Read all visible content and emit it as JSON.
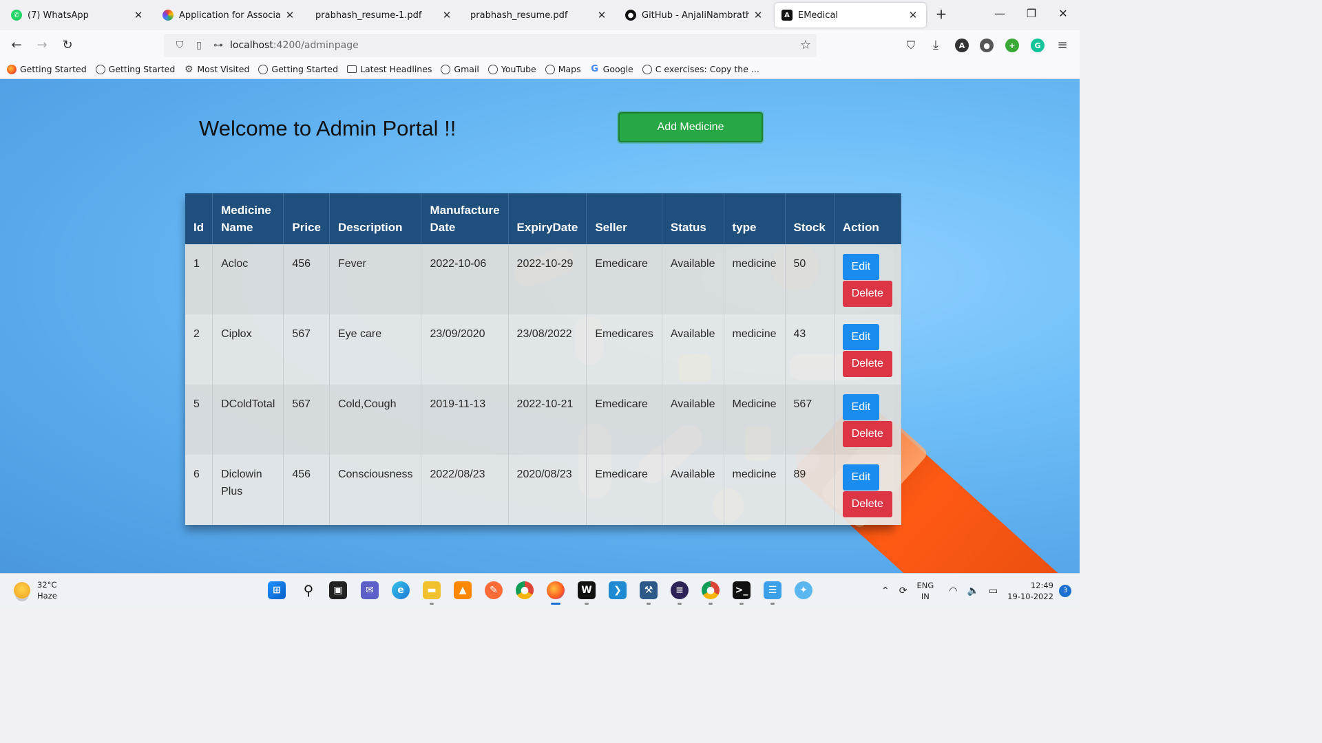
{
  "browser": {
    "tabs": [
      {
        "title": "(7) WhatsApp",
        "favicon": "whatsapp-icon",
        "color": "#25d366",
        "glyph": "✆",
        "active": false
      },
      {
        "title": "Application for Associate Softw",
        "favicon": "colorful-logo-icon",
        "color": "#7b3fe4",
        "glyph": "✿",
        "active": false
      },
      {
        "title": "prabhash_resume-1.pdf",
        "favicon": "",
        "color": "",
        "glyph": "",
        "active": false
      },
      {
        "title": "prabhash_resume.pdf",
        "favicon": "",
        "color": "",
        "glyph": "",
        "active": false
      },
      {
        "title": "GitHub - AnjaliNambrath/E-Me",
        "favicon": "github-icon",
        "color": "#111111",
        "glyph": "●",
        "active": false
      },
      {
        "title": "EMedical",
        "favicon": "angular-icon",
        "color": "#111111",
        "glyph": "A",
        "active": true
      }
    ],
    "url_host": "localhost",
    "url_path": ":4200/adminpage",
    "bookmarks": [
      {
        "label": "Getting Started",
        "icon": "firefox-icon"
      },
      {
        "label": "Getting Started",
        "icon": "globe-icon"
      },
      {
        "label": "Most Visited",
        "icon": "gear-icon"
      },
      {
        "label": "Getting Started",
        "icon": "globe-icon"
      },
      {
        "label": "Latest Headlines",
        "icon": "folder-icon"
      },
      {
        "label": "Gmail",
        "icon": "globe-icon"
      },
      {
        "label": "YouTube",
        "icon": "globe-icon"
      },
      {
        "label": "Maps",
        "icon": "globe-icon"
      },
      {
        "label": "Google",
        "icon": "google-icon"
      },
      {
        "label": "C exercises: Copy the ...",
        "icon": "globe-icon"
      }
    ]
  },
  "page": {
    "welcome": "Welcome to Admin Portal !!",
    "add_button": "Add Medicine",
    "table": {
      "headers": [
        "Id",
        "Medicine Name",
        "Price",
        "Description",
        "Manufacture Date",
        "ExpiryDate",
        "Seller",
        "Status",
        "type",
        "Stock",
        "Action"
      ],
      "rows": [
        {
          "id": "1",
          "name": "Acloc",
          "price": "456",
          "description": "Fever",
          "mfg": "2022-10-06",
          "expiry": "2022-10-29",
          "seller": "Emedicare",
          "status": "Available",
          "type": "medicine",
          "stock": "50"
        },
        {
          "id": "2",
          "name": "Ciplox",
          "price": "567",
          "description": "Eye care",
          "mfg": "23/09/2020",
          "expiry": "23/08/2022",
          "seller": "Emedicares",
          "status": "Available",
          "type": "medicine",
          "stock": "43"
        },
        {
          "id": "5",
          "name": "DColdTotal",
          "price": "567",
          "description": "Cold,Cough",
          "mfg": "2019-11-13",
          "expiry": "2022-10-21",
          "seller": "Emedicare",
          "status": "Available",
          "type": "Medicine",
          "stock": "567"
        },
        {
          "id": "6",
          "name": "Diclowin Plus",
          "price": "456",
          "description": "Consciousness",
          "mfg": "2022/08/23",
          "expiry": "2020/08/23",
          "seller": "Emedicare",
          "status": "Available",
          "type": "medicine",
          "stock": "89"
        }
      ],
      "edit_label": "Edit",
      "delete_label": "Delete"
    }
  },
  "taskbar": {
    "temperature": "32°C",
    "weather": "Haze",
    "lang_top": "ENG",
    "lang_bottom": "IN",
    "time": "12:49",
    "date": "19-10-2022",
    "notifications": "3"
  },
  "colors": {
    "header_bg": "#1f4f7d",
    "add_button": "#28a745",
    "edit_button": "#1a8cf0",
    "delete_button": "#dc3545"
  }
}
